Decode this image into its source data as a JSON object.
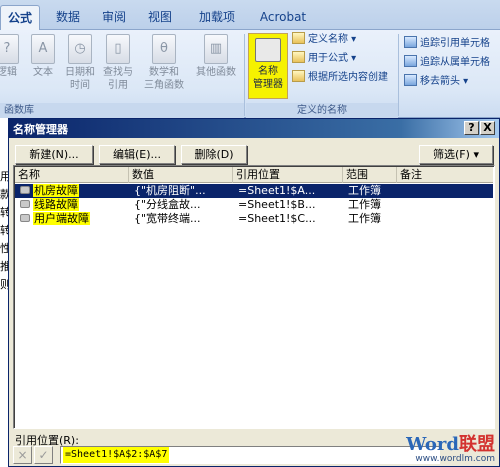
{
  "ribbon": {
    "tabs": [
      {
        "label": "公式",
        "active": true
      },
      {
        "label": "数据"
      },
      {
        "label": "审阅"
      },
      {
        "label": "视图"
      },
      {
        "label": "加载项"
      },
      {
        "label": "Acrobat"
      }
    ],
    "func_buttons": [
      {
        "label1": "逻辑",
        "label2": ""
      },
      {
        "label1": "文本",
        "label2": ""
      },
      {
        "label1": "日期和",
        "label2": "时间"
      },
      {
        "label1": "查找与",
        "label2": "引用"
      },
      {
        "label1": "数学和",
        "label2": "三角函数"
      },
      {
        "label1": "其他函数",
        "label2": ""
      }
    ],
    "group_func_library": "函数库",
    "name_manager": {
      "label1": "名称",
      "label2": "管理器"
    },
    "defined_names_items": [
      "定义名称",
      "用于公式",
      "根据所选内容创建"
    ],
    "group_defined_names": "定义的名称",
    "audit_items": [
      "追踪引用单元格",
      "追踪从属单元格",
      "移去箭头"
    ]
  },
  "sheet_cells": [
    "用",
    "款",
    "转",
    "转",
    "性",
    "推",
    "则"
  ],
  "dialog": {
    "title": "名称管理器",
    "close_label": "X",
    "help_label": "?",
    "buttons": {
      "new": "新建(N)...",
      "edit": "编辑(E)...",
      "delete": "删除(D)",
      "filter": "筛选(F)"
    },
    "columns": [
      "名称",
      "数值",
      "引用位置",
      "范围",
      "备注"
    ],
    "rows": [
      {
        "name": "机房故障",
        "value": "{\"机房阻断\"...",
        "ref": "=Sheet1!$A...",
        "scope": "工作簿",
        "note": "",
        "selected": true
      },
      {
        "name": "线路故障",
        "value": "{\"分线盒故...",
        "ref": "=Sheet1!$B...",
        "scope": "工作簿",
        "note": ""
      },
      {
        "name": "用户端故障",
        "value": "{\"宽带终端...",
        "ref": "=Sheet1!$C...",
        "scope": "工作簿",
        "note": ""
      }
    ],
    "ref_label": "引用位置(R):",
    "ref_value": "=Sheet1!$A$2:$A$7",
    "cancel_icon": "×",
    "confirm_icon": "✓"
  },
  "watermark": {
    "brand_word": "Word",
    "brand_cn": "联盟",
    "url": "www.wordlm.com"
  }
}
